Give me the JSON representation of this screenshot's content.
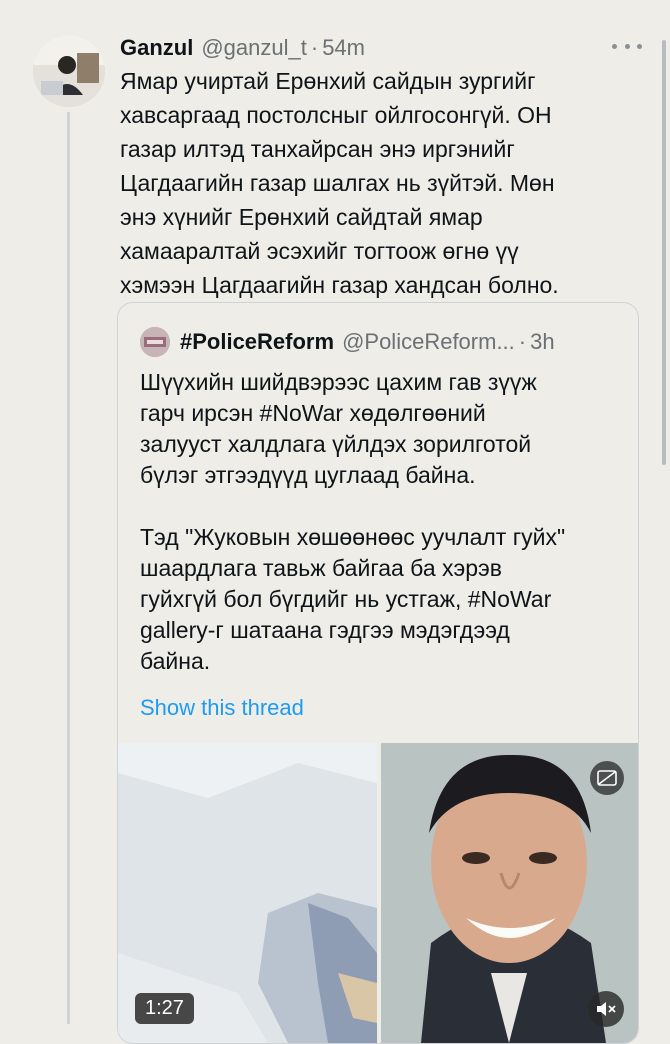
{
  "tweet": {
    "author_name": "Ganzul",
    "author_handle": "@ganzul_t",
    "separator": "·",
    "time": "54m",
    "text": "Ямар учиртай Ерөнхий сайдын зургийг\nхавсаргаад постолсныг ойлгосонгүй. ОН\nгазар илтэд танхайрсан энэ иргэнийг\nЦагдаагийн газар шалгах нь зүйтэй. Мөн\nэнэ хүнийг Ерөнхий сайдтай ямар\nхамааралтай эсэхийг тогтоож өгнө үү\nхэмээн Цагдаагийн газар хандсан болно."
  },
  "quoted": {
    "author_name": "#PoliceReform",
    "author_handle": "@PoliceReform...",
    "separator": "·",
    "time": "3h",
    "text": "Шүүхийн шийдвэрээс цахим гав зүүж\nгарч ирсэн #NoWar хөдөлгөөний\nзалууст халдлага үйлдэх зорилготой\nбүлэг этгээдүүд цуглаад байна.\n\nТэд \"Жуковын хөшөөнөөс уучлалт гуйх\"\nшаардлага тавьж байгаа ба хэрэв\nгуйхгүй бол бүгдийг нь устгаж, #NoWar\ngallery-г шатаана гэдгээ мэдэгдээд\nбайна.",
    "show_thread": "Show this thread",
    "video_duration": "1:27"
  },
  "icons": {
    "more": "more-horizontal-icon",
    "captions": "captions-icon",
    "mute": "muted-speaker-icon"
  },
  "colors": {
    "background": "#eeede8",
    "link": "#1d9bf0",
    "secondary_text": "#6b7075"
  }
}
